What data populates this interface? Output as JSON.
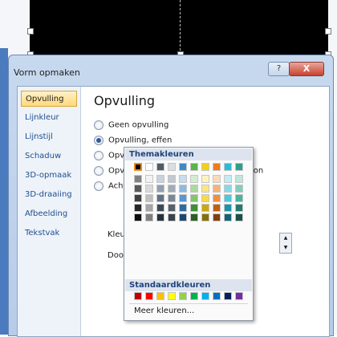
{
  "dialog": {
    "title": "Vorm opmaken",
    "help_label": "?",
    "close_label": "X"
  },
  "sidebar": {
    "items": [
      {
        "label": "Opvulling",
        "active": true
      },
      {
        "label": "Lijnkleur",
        "active": false
      },
      {
        "label": "Lijnstijl",
        "active": false
      },
      {
        "label": "Schaduw",
        "active": false
      },
      {
        "label": "3D-opmaak",
        "active": false
      },
      {
        "label": "3D-draaiing",
        "active": false
      },
      {
        "label": "Afbeelding",
        "active": false
      },
      {
        "label": "Tekstvak",
        "active": false
      }
    ]
  },
  "main": {
    "heading": "Opvulling",
    "radios": [
      {
        "label": "Geen opvulling",
        "checked": false
      },
      {
        "label": "Opvulling, effen",
        "checked": true
      },
      {
        "label": "Opvulling met kleurovergang",
        "checked": false
      },
      {
        "label": "Opvulling met figuur of bitmappatroon",
        "checked": false
      },
      {
        "label": "Achtergrondopvulling voor dia",
        "checked": false
      }
    ],
    "color_label": "Kleur:",
    "transparency_label": "Doorzich",
    "current_color": "#000000"
  },
  "color_picker": {
    "theme_heading": "Themakleuren",
    "standard_heading": "Standaardkleuren",
    "more_colors_label": "Meer kleuren...",
    "theme_colors": [
      [
        "#000000",
        "#ffffff",
        "#4f5b66",
        "#d9dee4",
        "#3f89c9",
        "#57b54a",
        "#f2d017",
        "#f07a1f",
        "#2dbbd6",
        "#2f9e8a"
      ],
      [
        "#808080",
        "#f2f2f2",
        "#c9d2dc",
        "#c0c8d0",
        "#c6dcf0",
        "#d4ecd0",
        "#fcf3c2",
        "#fbd9bb",
        "#c2ecf4",
        "#bfe6dd"
      ],
      [
        "#595959",
        "#d9d9d9",
        "#8fa0b2",
        "#a2acb8",
        "#8eb9e3",
        "#a9da9f",
        "#f9e785",
        "#f7b27a",
        "#86d8e9",
        "#83cdbb"
      ],
      [
        "#404040",
        "#bfbfbf",
        "#5f7488",
        "#7a8796",
        "#5797d4",
        "#7fc76f",
        "#f6db48",
        "#f38d40",
        "#4fc7de",
        "#4bb39b"
      ],
      [
        "#262626",
        "#a6a6a6",
        "#3b4a58",
        "#55606c",
        "#2c6aa3",
        "#3f8f35",
        "#c9a90e",
        "#c35d12",
        "#1d93aa",
        "#247a6a"
      ],
      [
        "#0d0d0d",
        "#7f7f7f",
        "#27313b",
        "#3a424b",
        "#1d4770",
        "#2a6024",
        "#86700a",
        "#82400c",
        "#136373",
        "#185247"
      ]
    ],
    "standard_colors": [
      "#c00000",
      "#ff0000",
      "#ffc000",
      "#ffff00",
      "#92d050",
      "#00b050",
      "#00b0f0",
      "#0070c0",
      "#002060",
      "#7030a0"
    ]
  }
}
